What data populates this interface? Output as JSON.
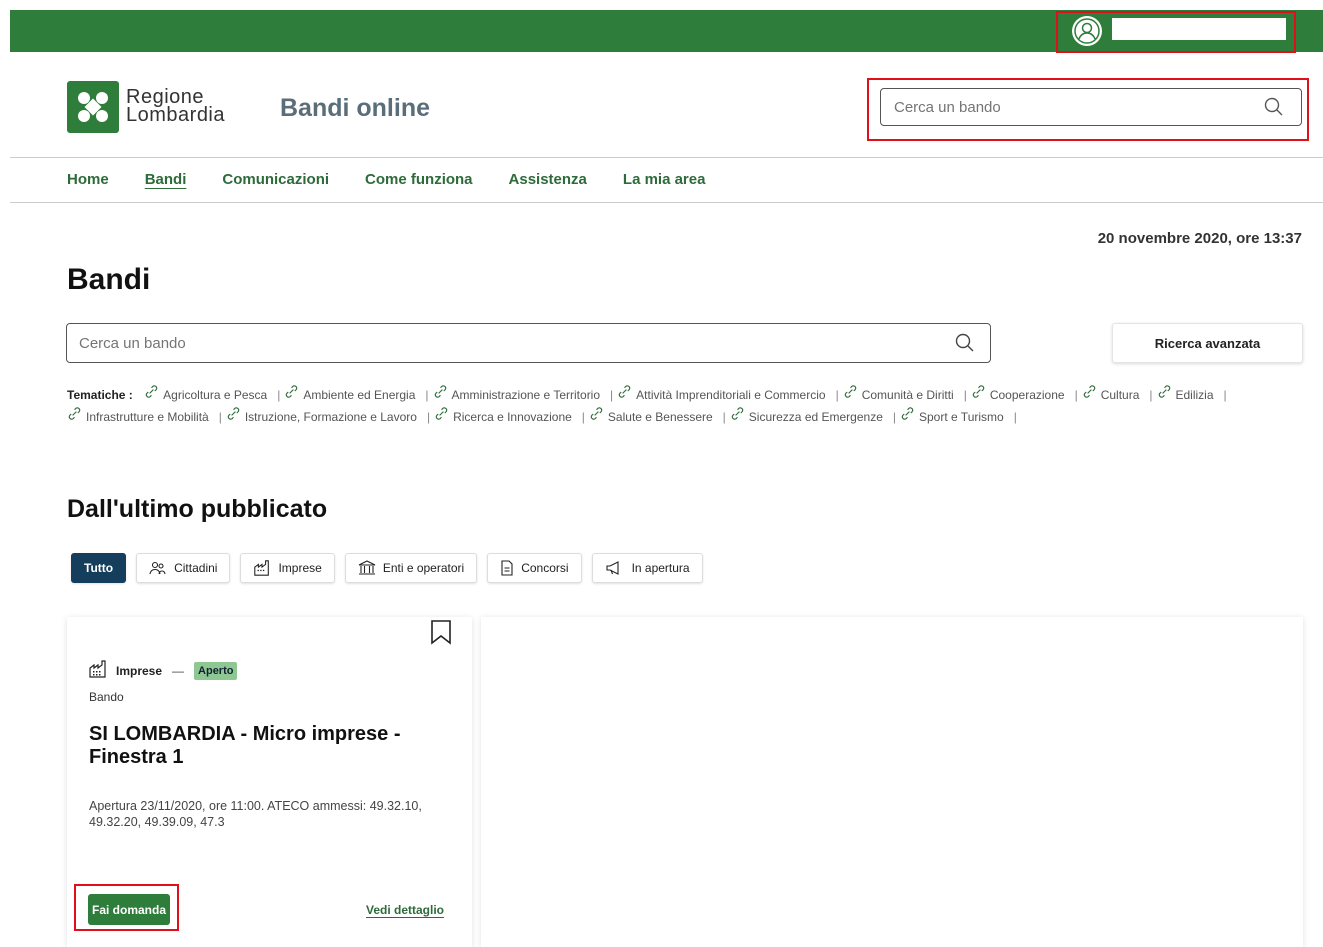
{
  "header": {
    "site_title": "Bandi online",
    "logo_line1": "Regione",
    "logo_line2": "Lombardia",
    "search_placeholder": "Cerca un bando",
    "user_name": ""
  },
  "nav": {
    "items": [
      {
        "label": "Home",
        "active": false
      },
      {
        "label": "Bandi",
        "active": true
      },
      {
        "label": "Comunicazioni",
        "active": false
      },
      {
        "label": "Come funziona",
        "active": false
      },
      {
        "label": "Assistenza",
        "active": false
      },
      {
        "label": "La mia area",
        "active": false
      }
    ]
  },
  "main": {
    "date": "20 novembre 2020, ore 13:37",
    "page_title": "Bandi",
    "search_placeholder": "Cerca un bando",
    "advanced_search_label": "Ricerca avanzata",
    "tematiche_label": "Tematiche :",
    "tematiche": [
      "Agricoltura e Pesca",
      "Ambiente ed Energia",
      "Amministrazione e Territorio",
      "Attività Imprenditoriali e Commercio",
      "Comunità e Diritti",
      "Cooperazione",
      "Cultura",
      "Edilizia",
      "Infrastrutture e Mobilità",
      "Istruzione, Formazione e Lavoro",
      "Ricerca e Innovazione",
      "Salute e Benessere",
      "Sicurezza ed Emergenze",
      "Sport e Turismo"
    ],
    "section_title": "Dall'ultimo pubblicato",
    "filters": [
      {
        "label": "Tutto",
        "icon": "",
        "active": true
      },
      {
        "label": "Cittadini",
        "icon": "people-icon",
        "active": false
      },
      {
        "label": "Imprese",
        "icon": "factory-icon",
        "active": false
      },
      {
        "label": "Enti e operatori",
        "icon": "institution-icon",
        "active": false
      },
      {
        "label": "Concorsi",
        "icon": "document-icon",
        "active": false
      },
      {
        "label": "In apertura",
        "icon": "megaphone-icon",
        "active": false
      }
    ]
  },
  "card": {
    "category": "Imprese",
    "status": "Aperto",
    "type": "Bando",
    "title": "SI LOMBARDIA - Micro imprese - Finestra 1",
    "description": "Apertura 23/11/2020, ore 11:00. ATECO ammessi: 49.32.10, 49.32.20, 49.39.09, 47.3",
    "apply_label": "Fai domanda",
    "detail_label": "Vedi dettaglio"
  },
  "colors": {
    "brand_green": "#2e7d3a",
    "active_filter": "#153d5c",
    "status_badge": "#8fc793",
    "highlight_red": "#e0101a"
  }
}
